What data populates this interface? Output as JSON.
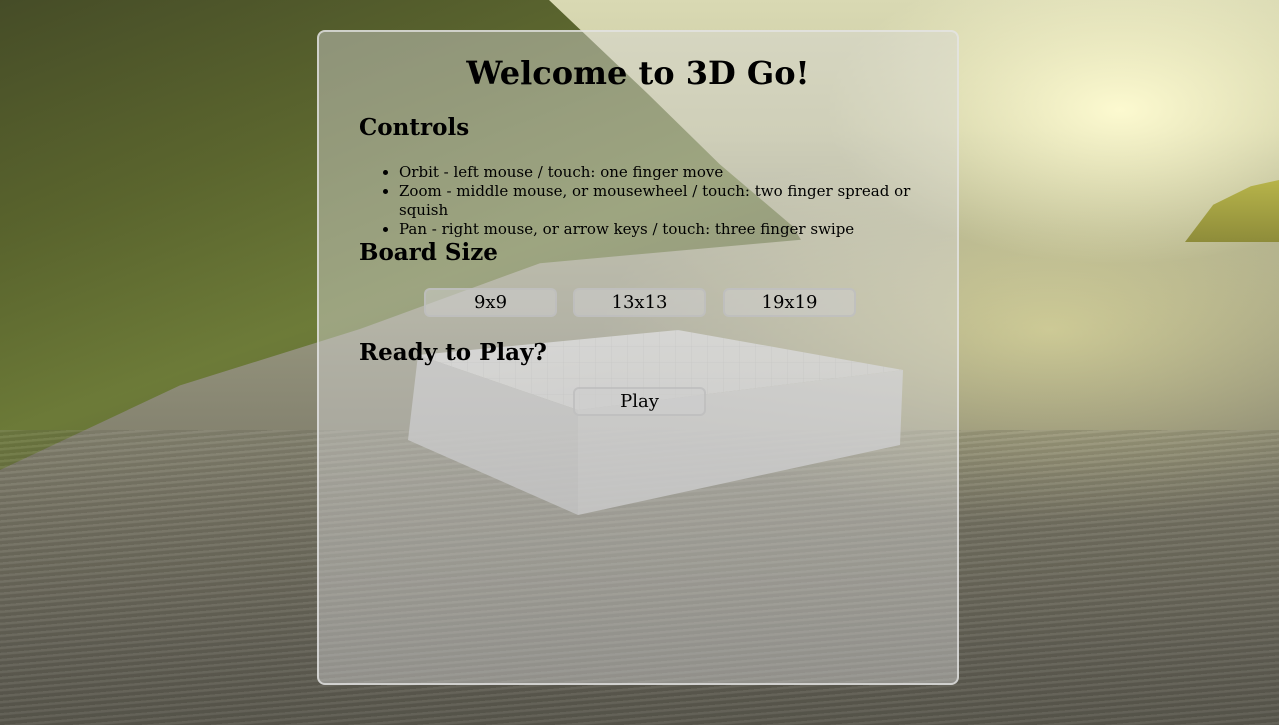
{
  "page": {
    "title": "Welcome to 3D Go!"
  },
  "controls": {
    "heading": "Controls",
    "items": [
      "Orbit - left mouse / touch: one finger move",
      "Zoom - middle mouse, or mousewheel / touch: two finger spread or squish",
      "Pan - right mouse, or arrow keys / touch: three finger swipe"
    ]
  },
  "board_size": {
    "heading": "Board Size",
    "options": [
      "9x9",
      "13x13",
      "19x19"
    ]
  },
  "ready": {
    "heading": "Ready to Play?",
    "play_label": "Play"
  },
  "colors": {
    "panel_background": "#d7d7d7",
    "panel_border": "#e6e6e6",
    "button_background": "#cdcdcd",
    "button_border": "#bebebe",
    "text": "#000000"
  }
}
